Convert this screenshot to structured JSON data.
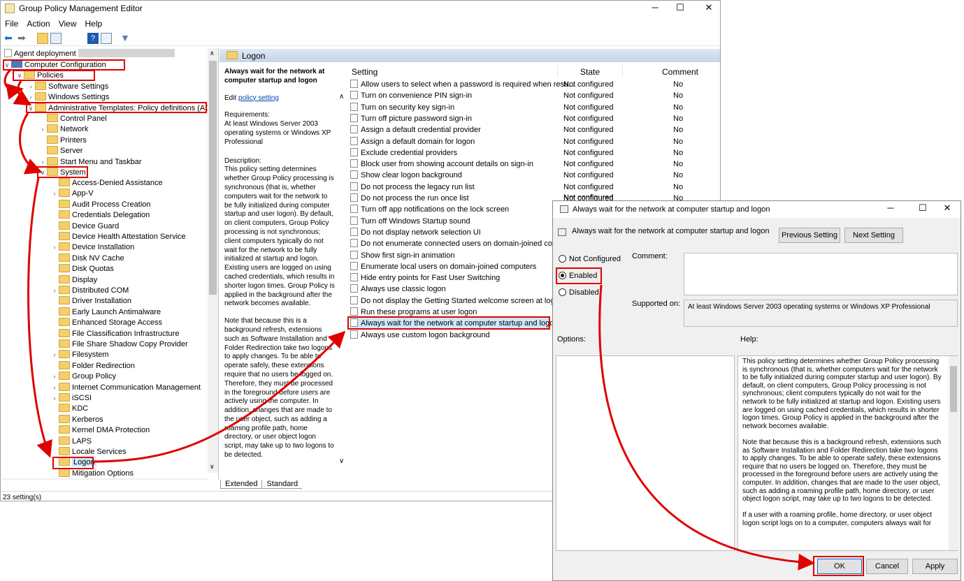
{
  "window": {
    "title": "Group Policy Management Editor"
  },
  "menu": [
    "File",
    "Action",
    "View",
    "Help"
  ],
  "tree": {
    "root": "Agent deployment",
    "computer_configuration": "Computer Configuration",
    "policies": "Policies",
    "software_settings": "Software Settings",
    "windows_settings": "Windows Settings",
    "admin_templates": "Administrative Templates: Policy definitions (ADM",
    "admin_children": [
      "Control Panel",
      "Network",
      "Printers",
      "Server",
      "Start Menu and Taskbar"
    ],
    "system": "System",
    "system_children": [
      "Access-Denied Assistance",
      "App-V",
      "Audit Process Creation",
      "Credentials Delegation",
      "Device Guard",
      "Device Health Attestation Service",
      "Device Installation",
      "Disk NV Cache",
      "Disk Quotas",
      "Display",
      "Distributed COM",
      "Driver Installation",
      "Early Launch Antimalware",
      "Enhanced Storage Access",
      "File Classification Infrastructure",
      "File Share Shadow Copy Provider",
      "Filesystem",
      "Folder Redirection",
      "Group Policy",
      "Internet Communication Management",
      "iSCSI",
      "KDC",
      "Kerberos",
      "Kernel DMA Protection",
      "LAPS",
      "Locale Services",
      "Logon",
      "Mitigation Options"
    ]
  },
  "category": {
    "title": "Logon"
  },
  "description": {
    "title": "Always wait for the network at computer startup and logon",
    "edit_prefix": "Edit ",
    "edit_link": "policy setting",
    "requirements_label": "Requirements:",
    "requirements": "At least Windows Server 2003 operating systems or Windows XP Professional",
    "description_label": "Description:",
    "para1": "This policy setting determines whether Group Policy processing is synchronous (that is, whether computers wait for the network to be fully initialized during computer startup and user logon). By default, on client computers, Group Policy processing is not synchronous; client computers typically do not wait for the network to be fully initialized at startup and logon. Existing users are logged on using cached credentials, which results in shorter logon times. Group Policy is applied in the background after the network becomes available.",
    "para2": "Note that because this is a background refresh, extensions such as Software Installation and Folder Redirection take two logons to apply changes. To be able to operate safely, these extensions require that no users be logged on. Therefore, they must be processed in the foreground before users are actively using the computer. In addition, changes that are made to the user object, such as adding a roaming profile path, home directory, or user object logon script, may take up to two logons to be detected."
  },
  "settings_table": {
    "headers": {
      "setting": "Setting",
      "state": "State",
      "comment": "Comment"
    },
    "rows": [
      {
        "name": "Allow users to select when a password is required when resu...",
        "state": "Not configured",
        "comment": "No"
      },
      {
        "name": "Turn on convenience PIN sign-in",
        "state": "Not configured",
        "comment": "No"
      },
      {
        "name": "Turn on security key sign-in",
        "state": "Not configured",
        "comment": "No"
      },
      {
        "name": "Turn off picture password sign-in",
        "state": "Not configured",
        "comment": "No"
      },
      {
        "name": "Assign a default credential provider",
        "state": "Not configured",
        "comment": "No"
      },
      {
        "name": "Assign a default domain for logon",
        "state": "Not configured",
        "comment": "No"
      },
      {
        "name": "Exclude credential providers",
        "state": "Not configured",
        "comment": "No"
      },
      {
        "name": "Block user from showing account details on sign-in",
        "state": "Not configured",
        "comment": "No"
      },
      {
        "name": "Show clear logon background",
        "state": "Not configured",
        "comment": "No"
      },
      {
        "name": "Do not process the legacy run list",
        "state": "Not configured",
        "comment": "No"
      },
      {
        "name": "Do not process the run once list",
        "state": "Not configured",
        "comment": "No"
      },
      {
        "name": "Turn off app notifications on the lock screen",
        "state": "",
        "comment": ""
      },
      {
        "name": "Turn off Windows Startup sound",
        "state": "",
        "comment": ""
      },
      {
        "name": "Do not display network selection UI",
        "state": "",
        "comment": ""
      },
      {
        "name": "Do not enumerate connected users on domain-joined com...",
        "state": "",
        "comment": ""
      },
      {
        "name": "Show first sign-in animation",
        "state": "",
        "comment": ""
      },
      {
        "name": "Enumerate local users on domain-joined computers",
        "state": "",
        "comment": ""
      },
      {
        "name": "Hide entry points for Fast User Switching",
        "state": "",
        "comment": ""
      },
      {
        "name": "Always use classic logon",
        "state": "",
        "comment": ""
      },
      {
        "name": "Do not display the Getting Started welcome screen at logon",
        "state": "",
        "comment": ""
      },
      {
        "name": "Run these programs at user logon",
        "state": "",
        "comment": ""
      },
      {
        "name": "Always wait for the network at computer startup and logon",
        "state": "",
        "comment": ""
      },
      {
        "name": "Always use custom logon background",
        "state": "",
        "comment": ""
      }
    ],
    "partial_row_state": "Not configured"
  },
  "tabs": {
    "extended": "Extended",
    "standard": "Standard"
  },
  "status": "23 setting(s)",
  "dialog": {
    "title": "Always wait for the network at computer startup and logon",
    "header": "Always wait for the network at computer startup and logon",
    "previous": "Previous Setting",
    "next": "Next Setting",
    "not_configured": "Not Configured",
    "enabled": "Enabled",
    "disabled": "Disabled",
    "comment_label": "Comment:",
    "supported_label": "Supported on:",
    "supported_value": "At least Windows Server 2003 operating systems or Windows XP Professional",
    "options_label": "Options:",
    "help_label": "Help:",
    "help_p1": "This policy setting determines whether Group Policy processing is synchronous (that is, whether computers wait for the network to be fully initialized during computer startup and user logon). By default, on client computers, Group Policy processing is not synchronous; client computers typically do not wait for the network to be fully initialized at startup and logon. Existing users are logged on using cached credentials, which results in shorter logon times. Group Policy is applied in the background after the network becomes available.",
    "help_p2": "Note that because this is a background refresh, extensions such as Software Installation and Folder Redirection take two logons to apply changes. To be able to operate safely, these extensions require that no users be logged on. Therefore, they must be processed in the foreground before users are actively using the computer. In addition, changes that are made to the user object, such as adding a roaming profile path, home directory, or user object logon script, may take up to two logons to be detected.",
    "help_p3": "If a user with a roaming profile, home directory, or user object logon script logs on to a computer, computers always wait for",
    "ok": "OK",
    "cancel": "Cancel",
    "apply": "Apply"
  },
  "colors": {
    "annotation": "#e00000",
    "selection": "#cce8ff",
    "header": "#c6d5e7"
  }
}
